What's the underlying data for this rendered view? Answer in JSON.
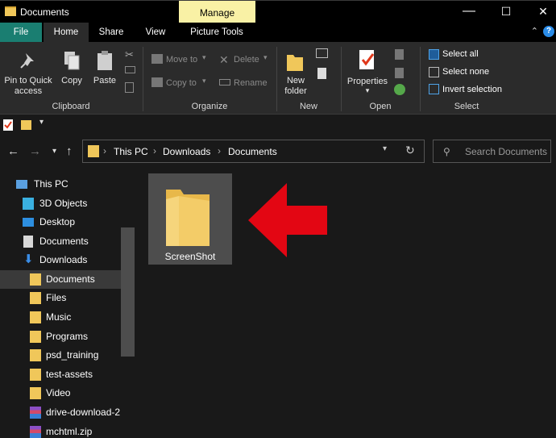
{
  "window": {
    "title": "Documents",
    "context_tab": "Manage"
  },
  "window_controls": {
    "minimize": "—",
    "maximize": "☐",
    "close": "✕"
  },
  "tabs": [
    "File",
    "Home",
    "Share",
    "View",
    "Picture Tools"
  ],
  "ribbon": {
    "clipboard": {
      "pin": [
        "Pin to Quick",
        "access"
      ],
      "copy": "Copy",
      "paste": "Paste",
      "label": "Clipboard"
    },
    "organize": {
      "move_to": "Move to",
      "copy_to": "Copy to",
      "delete": "Delete",
      "rename": "Rename",
      "label": "Organize"
    },
    "new": {
      "new_folder": [
        "New",
        "folder"
      ],
      "label": "New"
    },
    "open": {
      "properties": "Properties",
      "label": "Open"
    },
    "select": {
      "select_all": "Select all",
      "select_none": "Select none",
      "invert": "Invert selection",
      "label": "Select"
    }
  },
  "address": {
    "crumbs": [
      "This PC",
      "Downloads",
      "Documents"
    ]
  },
  "search": {
    "placeholder": "Search Documents"
  },
  "sidebar": {
    "items": [
      {
        "label": "This PC",
        "icon": "pc-icon"
      },
      {
        "label": "3D Objects",
        "icon": "cube-icon"
      },
      {
        "label": "Desktop",
        "icon": "desktop-icon"
      },
      {
        "label": "Documents",
        "icon": "document-icon"
      },
      {
        "label": "Downloads",
        "icon": "download-icon"
      },
      {
        "label": "Documents",
        "icon": "folder-icon",
        "selected": true
      },
      {
        "label": "Files",
        "icon": "folder-icon"
      },
      {
        "label": "Music",
        "icon": "folder-icon"
      },
      {
        "label": "Programs",
        "icon": "folder-icon"
      },
      {
        "label": "psd_training",
        "icon": "folder-icon"
      },
      {
        "label": "test-assets",
        "icon": "folder-icon"
      },
      {
        "label": "Video",
        "icon": "folder-icon"
      },
      {
        "label": "drive-download-2",
        "icon": "zip-icon"
      },
      {
        "label": "mchtml.zip",
        "icon": "zip-icon"
      }
    ]
  },
  "content": {
    "items": [
      {
        "name": "ScreenShot",
        "type": "folder",
        "selected": true
      }
    ]
  },
  "colors": {
    "accent": "#1a7e71",
    "manage": "#f9f1a5",
    "folder": "#f0c75a",
    "arrow": "#e30613"
  }
}
